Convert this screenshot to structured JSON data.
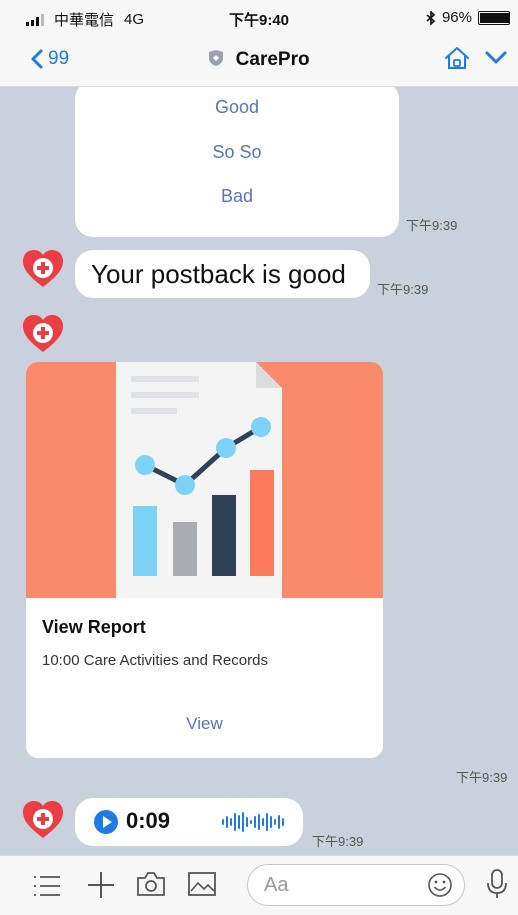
{
  "status": {
    "carrier": "中華電信",
    "network": "4G",
    "time": "下午9:40",
    "battery": "96%",
    "battery_level": 0.96
  },
  "nav": {
    "back_count": "99",
    "title": "CarePro"
  },
  "messages": {
    "options": [
      "Good",
      "So So",
      "Bad"
    ],
    "options_time": "下午9:39",
    "reply_text": "Your postback is good",
    "reply_time": "下午9:39",
    "report": {
      "title": "View Report",
      "subtitle": "10:00 Care Activities and Records",
      "action": "View",
      "time": "下午9:39"
    },
    "voice": {
      "duration": "0:09",
      "time": "下午9:39"
    }
  },
  "input": {
    "placeholder": "Aa"
  },
  "colors": {
    "accent": "#1e7be6",
    "option_text": "#5a74b8",
    "hero": "#fb8a6b",
    "chat_bg": "#c9d1dc"
  }
}
